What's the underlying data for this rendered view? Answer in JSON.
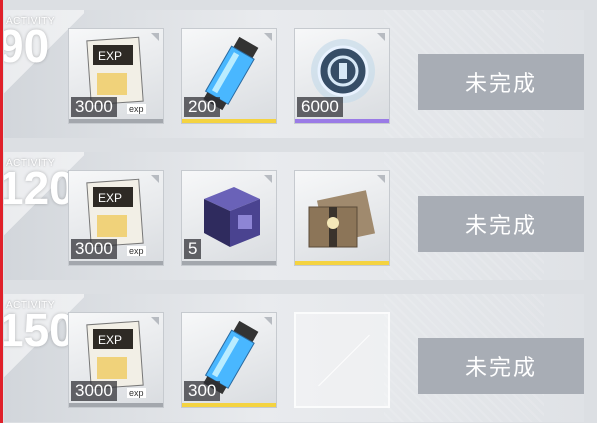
{
  "activity_label": "ACTIVITY",
  "rows": [
    {
      "threshold": "90",
      "rewards": [
        {
          "icon": "exp-document-icon",
          "quantity": "3000",
          "tag": "exp",
          "rarity": "common"
        },
        {
          "icon": "energy-canister-icon",
          "quantity": "200",
          "rarity": "gold"
        },
        {
          "icon": "currency-emblem-icon",
          "quantity": "6000",
          "rarity": "purple"
        }
      ],
      "status": "未完成"
    },
    {
      "threshold": "120",
      "rewards": [
        {
          "icon": "exp-document-icon",
          "quantity": "3000",
          "tag": "exp",
          "rarity": "common"
        },
        {
          "icon": "supply-crate-icon",
          "quantity": "5",
          "rarity": "common"
        },
        {
          "icon": "gift-pack-icon",
          "quantity": "",
          "rarity": "gold"
        }
      ],
      "status": "未完成"
    },
    {
      "threshold": "150",
      "rewards": [
        {
          "icon": "exp-document-icon",
          "quantity": "3000",
          "tag": "exp",
          "rarity": "common"
        },
        {
          "icon": "energy-canister-icon",
          "quantity": "300",
          "rarity": "gold"
        },
        {
          "icon": "empty-slot-icon",
          "quantity": "",
          "rarity": "empty"
        }
      ],
      "status": "未完成"
    }
  ],
  "colors": {
    "accent_red": "#e0202a",
    "gold": "#f4d341",
    "purple": "#9a7be6",
    "status_bg": "#a8adb5"
  }
}
